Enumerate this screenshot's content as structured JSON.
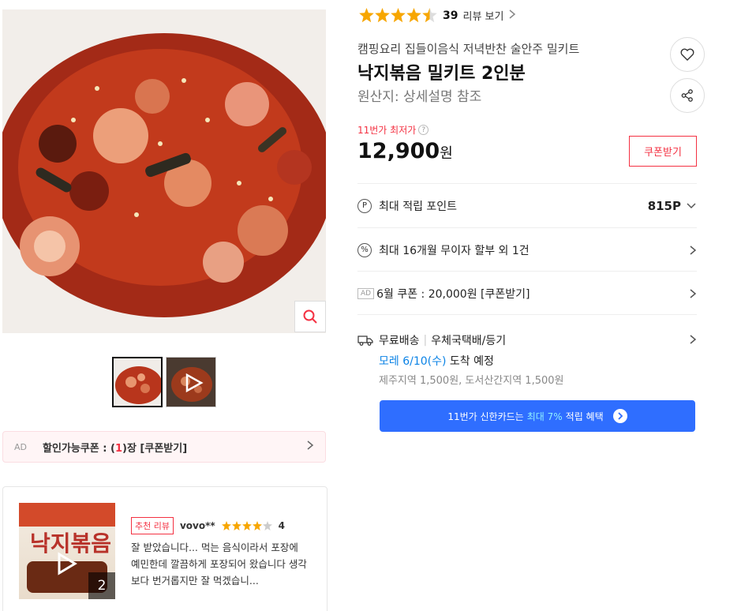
{
  "rating": {
    "value": 4.5,
    "count": "39",
    "link_label": "리뷰 보기"
  },
  "product": {
    "category": "캠핑요리 집들이음식 저녁반찬 술안주 밀키트",
    "title": "낙지볶음 밀키트 2인분",
    "origin": "원산지:  상세설명 참조"
  },
  "price": {
    "lowest_label": "11번가 최저가",
    "value": "12,900",
    "unit": "원",
    "coupon_button": "쿠폰받기"
  },
  "benefits": {
    "points": {
      "icon": "P",
      "label": "최대 적립 포인트",
      "value": "815P"
    },
    "installment": {
      "icon": "%",
      "label": "최대 16개월 무이자 할부 외 1건"
    },
    "coupon": {
      "ad": "AD",
      "label": "6월 쿠폰 : 20,000원 [쿠폰받기]"
    }
  },
  "shipping": {
    "type": "무료배송",
    "method": "우체국택배/등기",
    "arrival_date": "모레 6/10(수)",
    "arrival_suffix": " 도착 예정",
    "extra_fee": "제주지역 1,500원, 도서산간지역 1,500원"
  },
  "card_banner": {
    "prefix": "11번가 신한카드는",
    "highlight": "최대 7%",
    "suffix": "적립 혜택"
  },
  "left_coupon": {
    "ad": "AD",
    "label_prefix": "할인가능쿠폰 : (",
    "count": "1",
    "label_suffix": ")장 [쿠폰받기]"
  },
  "review": {
    "tag": "추천 리뷰",
    "reviewer": "vovo**",
    "score": "4",
    "body": "잘 받았습니다... 먹는 음식이라서 포장에 예민한데 깔끔하게 포장되어 왔습니다 생각보다 번거롭지만 잘 먹겠습니...",
    "image_title": "낙지볶음",
    "image_count": "2"
  },
  "colors": {
    "accent_red": "#f43142",
    "star": "#f7a600",
    "blue": "#2f6eff",
    "link_blue": "#0b83e6"
  }
}
